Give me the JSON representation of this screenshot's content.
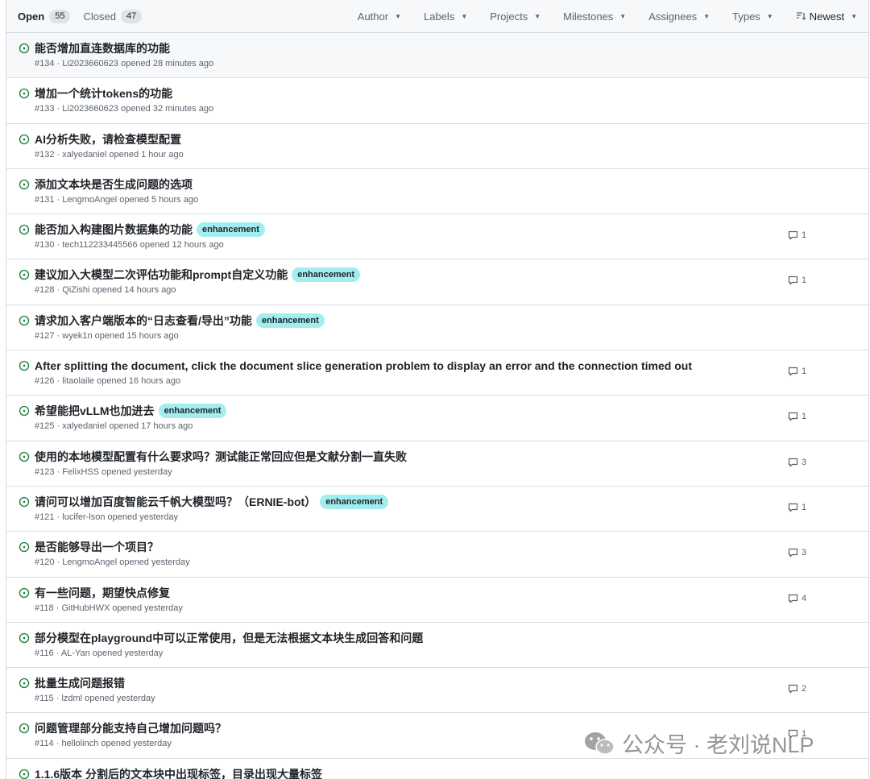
{
  "header": {
    "open_label": "Open",
    "open_count": "55",
    "closed_label": "Closed",
    "closed_count": "47",
    "filters": [
      "Author",
      "Labels",
      "Projects",
      "Milestones",
      "Assignees",
      "Types"
    ],
    "sort_label": "Newest"
  },
  "issues": [
    {
      "title": "能否增加直连数据库的功能",
      "number": "#134",
      "author": "Li2023660623",
      "time": "opened 28 minutes ago",
      "label": "",
      "comments": ""
    },
    {
      "title": "增加一个统计tokens的功能",
      "number": "#133",
      "author": "Li2023660623",
      "time": "opened 32 minutes ago",
      "label": "",
      "comments": ""
    },
    {
      "title": "AI分析失败，请检查模型配置",
      "number": "#132",
      "author": "xalyedaniel",
      "time": "opened 1 hour ago",
      "label": "",
      "comments": ""
    },
    {
      "title": "添加文本块是否生成问题的选项",
      "number": "#131",
      "author": "LengmoAngel",
      "time": "opened 5 hours ago",
      "label": "",
      "comments": ""
    },
    {
      "title": "能否加入构建图片数据集的功能",
      "number": "#130",
      "author": "tech112233445566",
      "time": "opened 12 hours ago",
      "label": "enhancement",
      "comments": "1"
    },
    {
      "title": "建议加入大模型二次评估功能和prompt自定义功能",
      "number": "#128",
      "author": "QiZishi",
      "time": "opened 14 hours ago",
      "label": "enhancement",
      "comments": "1"
    },
    {
      "title": "请求加入客户端版本的“日志查看/导出”功能",
      "number": "#127",
      "author": "wyek1n",
      "time": "opened 15 hours ago",
      "label": "enhancement",
      "comments": ""
    },
    {
      "title": "After splitting the document, click the document slice generation problem to display an error and the connection timed out",
      "number": "#126",
      "author": "litaolaile",
      "time": "opened 16 hours ago",
      "label": "",
      "comments": "1"
    },
    {
      "title": "希望能把vLLM也加进去",
      "number": "#125",
      "author": "xalyedaniel",
      "time": "opened 17 hours ago",
      "label": "enhancement",
      "comments": "1"
    },
    {
      "title": "使用的本地模型配置有什么要求吗？测试能正常回应但是文献分割一直失败",
      "number": "#123",
      "author": "FelixHSS",
      "time": "opened yesterday",
      "label": "",
      "comments": "3"
    },
    {
      "title": "请问可以增加百度智能云千帆大模型吗？（ERNIE-bot）",
      "number": "#121",
      "author": "lucifer-lson",
      "time": "opened yesterday",
      "label": "enhancement",
      "comments": "1"
    },
    {
      "title": "是否能够导出一个项目？",
      "number": "#120",
      "author": "LengmoAngel",
      "time": "opened yesterday",
      "label": "",
      "comments": "3"
    },
    {
      "title": "有一些问题，期望快点修复",
      "number": "#118",
      "author": "GitHubHWX",
      "time": "opened yesterday",
      "label": "",
      "comments": "4"
    },
    {
      "title": "部分模型在playground中可以正常使用，但是无法根据文本块生成回答和问题",
      "number": "#116",
      "author": "AL-Yan",
      "time": "opened yesterday",
      "label": "",
      "comments": ""
    },
    {
      "title": "批量生成问题报错",
      "number": "#115",
      "author": "lzdml",
      "time": "opened yesterday",
      "label": "",
      "comments": "2"
    },
    {
      "title": "问题管理部分能支持自己增加问题吗？",
      "number": "#114",
      "author": "hellolinch",
      "time": "opened yesterday",
      "label": "",
      "comments": "1"
    },
    {
      "title": "1.1.6版本 分割后的文本块中出现标签，目录出现大量标签",
      "number": "",
      "author": "",
      "time": "",
      "label": "",
      "comments": ""
    }
  ],
  "watermark": {
    "text": "公众号 · 老刘说NLP"
  },
  "colors": {
    "open_green": "#1a7f37",
    "enhancement_label": "#a2eeef"
  }
}
